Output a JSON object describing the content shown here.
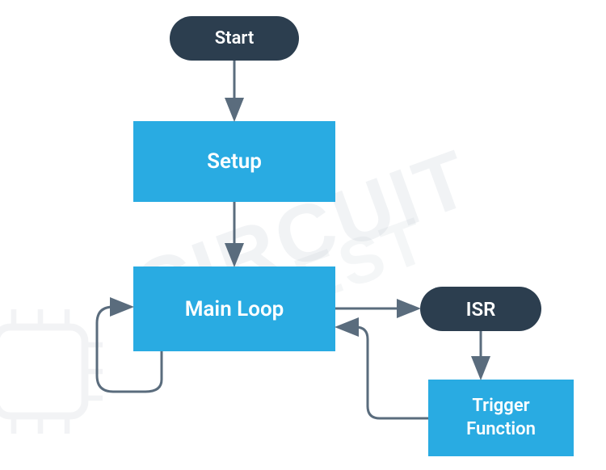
{
  "nodes": {
    "start": {
      "label": "Start"
    },
    "setup": {
      "label": "Setup"
    },
    "mainloop": {
      "label": "Main Loop"
    },
    "isr": {
      "label": "ISR"
    },
    "trigger": {
      "label": "Trigger\nFunction"
    }
  },
  "watermark": {
    "line1": "CIRCUIT",
    "line2": "DIGEST"
  },
  "colors": {
    "rounded": "#2c3e4f",
    "rect": "#29abe2",
    "arrow": "#5a6c7d"
  }
}
